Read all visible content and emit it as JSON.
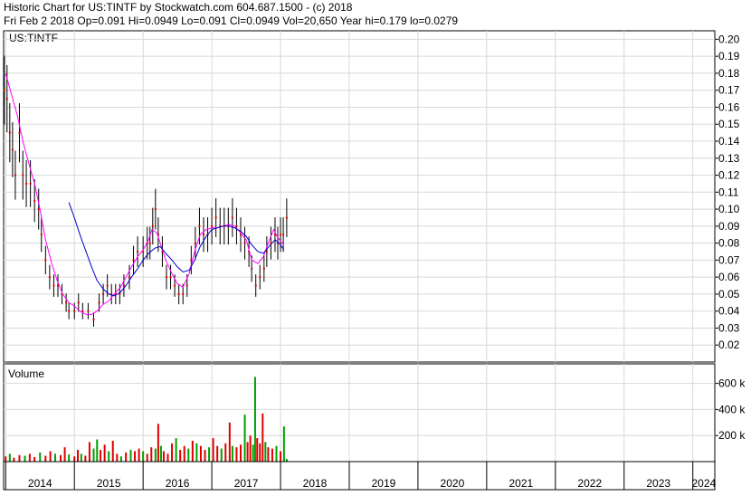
{
  "header": {
    "line1": "Historic Chart for US:TINTF by Stockwatch.com 604.687.1500 - (c) 2018",
    "line2": "Fri Feb  2 2018   Op=0.091   Hi=0.0949   Lo=0.091   Cl=0.0949   Vol=20,650   Year hi=0.179   lo=0.0279"
  },
  "price_panel": {
    "symbol_label": "US:TINTF"
  },
  "volume_panel": {
    "label": "Volume"
  },
  "colors": {
    "ma_short": "#ff00ff",
    "ma_long": "#0000cc",
    "vol_up": "#00a000",
    "vol_down": "#e00000",
    "grid": "#d8d8d8",
    "bars": "#000000"
  },
  "chart_data": [
    {
      "type": "line",
      "title": "Historic Chart for US:TINTF",
      "subtitle": "Fri Feb  2 2018   Op=0.091   Hi=0.0949   Lo=0.091   Cl=0.0949   Vol=20,650   Year hi=0.179   lo=0.0279",
      "ylim": [
        0.01,
        0.205
      ],
      "y_ticks": [
        "0.20",
        "0.19",
        "0.18",
        "0.17",
        "0.16",
        "0.15",
        "0.14",
        "0.13",
        "0.12",
        "0.11",
        "0.10",
        "0.09",
        "0.08",
        "0.07",
        "0.06",
        "0.05",
        "0.04",
        "0.03",
        "0.02"
      ],
      "x_ticks": [
        "2014",
        "2015",
        "2016",
        "2017",
        "2018",
        "2019",
        "2020",
        "2021",
        "2022",
        "2023",
        "2024"
      ],
      "xlim": [
        2013.97,
        2024.32
      ],
      "grid": true,
      "price_points": [
        {
          "x": 2013.98,
          "y": 0.17
        },
        {
          "x": 2014.02,
          "y": 0.165
        },
        {
          "x": 2014.06,
          "y": 0.145
        },
        {
          "x": 2014.1,
          "y": 0.135
        },
        {
          "x": 2014.14,
          "y": 0.12
        },
        {
          "x": 2014.2,
          "y": 0.145
        },
        {
          "x": 2014.25,
          "y": 0.12
        },
        {
          "x": 2014.3,
          "y": 0.115
        },
        {
          "x": 2014.36,
          "y": 0.115
        },
        {
          "x": 2014.42,
          "y": 0.105
        },
        {
          "x": 2014.48,
          "y": 0.1
        },
        {
          "x": 2014.52,
          "y": 0.085
        },
        {
          "x": 2014.58,
          "y": 0.07
        },
        {
          "x": 2014.64,
          "y": 0.06
        },
        {
          "x": 2014.7,
          "y": 0.055
        },
        {
          "x": 2014.76,
          "y": 0.055
        },
        {
          "x": 2014.82,
          "y": 0.05
        },
        {
          "x": 2014.88,
          "y": 0.045
        },
        {
          "x": 2014.92,
          "y": 0.04
        },
        {
          "x": 2015.0,
          "y": 0.04
        },
        {
          "x": 2015.06,
          "y": 0.045
        },
        {
          "x": 2015.12,
          "y": 0.04
        },
        {
          "x": 2015.2,
          "y": 0.04
        },
        {
          "x": 2015.28,
          "y": 0.035
        },
        {
          "x": 2015.36,
          "y": 0.045
        },
        {
          "x": 2015.42,
          "y": 0.05
        },
        {
          "x": 2015.48,
          "y": 0.055
        },
        {
          "x": 2015.54,
          "y": 0.05
        },
        {
          "x": 2015.6,
          "y": 0.05
        },
        {
          "x": 2015.66,
          "y": 0.05
        },
        {
          "x": 2015.72,
          "y": 0.055
        },
        {
          "x": 2015.8,
          "y": 0.06
        },
        {
          "x": 2015.86,
          "y": 0.07
        },
        {
          "x": 2015.92,
          "y": 0.075
        },
        {
          "x": 2016.0,
          "y": 0.075
        },
        {
          "x": 2016.06,
          "y": 0.08
        },
        {
          "x": 2016.1,
          "y": 0.08
        },
        {
          "x": 2016.14,
          "y": 0.09
        },
        {
          "x": 2016.18,
          "y": 0.1
        },
        {
          "x": 2016.22,
          "y": 0.085
        },
        {
          "x": 2016.28,
          "y": 0.075
        },
        {
          "x": 2016.34,
          "y": 0.06
        },
        {
          "x": 2016.4,
          "y": 0.06
        },
        {
          "x": 2016.46,
          "y": 0.055
        },
        {
          "x": 2016.52,
          "y": 0.05
        },
        {
          "x": 2016.58,
          "y": 0.05
        },
        {
          "x": 2016.64,
          "y": 0.055
        },
        {
          "x": 2016.7,
          "y": 0.07
        },
        {
          "x": 2016.76,
          "y": 0.08
        },
        {
          "x": 2016.82,
          "y": 0.09
        },
        {
          "x": 2016.88,
          "y": 0.085
        },
        {
          "x": 2016.94,
          "y": 0.085
        },
        {
          "x": 2017.0,
          "y": 0.09
        },
        {
          "x": 2017.06,
          "y": 0.095
        },
        {
          "x": 2017.12,
          "y": 0.09
        },
        {
          "x": 2017.18,
          "y": 0.09
        },
        {
          "x": 2017.24,
          "y": 0.09
        },
        {
          "x": 2017.3,
          "y": 0.095
        },
        {
          "x": 2017.36,
          "y": 0.09
        },
        {
          "x": 2017.42,
          "y": 0.085
        },
        {
          "x": 2017.48,
          "y": 0.08
        },
        {
          "x": 2017.54,
          "y": 0.075
        },
        {
          "x": 2017.58,
          "y": 0.065
        },
        {
          "x": 2017.64,
          "y": 0.055
        },
        {
          "x": 2017.7,
          "y": 0.06
        },
        {
          "x": 2017.76,
          "y": 0.065
        },
        {
          "x": 2017.8,
          "y": 0.075
        },
        {
          "x": 2017.86,
          "y": 0.08
        },
        {
          "x": 2017.92,
          "y": 0.085
        },
        {
          "x": 2017.96,
          "y": 0.08
        },
        {
          "x": 2018.0,
          "y": 0.085
        },
        {
          "x": 2018.04,
          "y": 0.085
        },
        {
          "x": 2018.09,
          "y": 0.0949
        }
      ],
      "series": [
        {
          "points": [
            [
              2014.0,
              0.18
            ],
            [
              2014.08,
              0.168
            ],
            [
              2014.17,
              0.155
            ],
            [
              2014.25,
              0.14
            ],
            [
              2014.33,
              0.128
            ],
            [
              2014.42,
              0.115
            ],
            [
              2014.5,
              0.1
            ],
            [
              2014.58,
              0.082
            ],
            [
              2014.67,
              0.068
            ],
            [
              2014.75,
              0.058
            ],
            [
              2014.83,
              0.05
            ],
            [
              2014.92,
              0.045
            ],
            [
              2015.0,
              0.043
            ],
            [
              2015.08,
              0.04
            ],
            [
              2015.17,
              0.038
            ],
            [
              2015.25,
              0.038
            ],
            [
              2015.33,
              0.04
            ],
            [
              2015.42,
              0.044
            ],
            [
              2015.5,
              0.046
            ],
            [
              2015.58,
              0.05
            ],
            [
              2015.67,
              0.054
            ],
            [
              2015.75,
              0.06
            ],
            [
              2015.83,
              0.066
            ],
            [
              2015.92,
              0.072
            ],
            [
              2016.0,
              0.076
            ],
            [
              2016.08,
              0.082
            ],
            [
              2016.13,
              0.088
            ],
            [
              2016.2,
              0.086
            ],
            [
              2016.25,
              0.08
            ],
            [
              2016.33,
              0.07
            ],
            [
              2016.42,
              0.062
            ],
            [
              2016.5,
              0.056
            ],
            [
              2016.58,
              0.054
            ],
            [
              2016.67,
              0.062
            ],
            [
              2016.75,
              0.075
            ],
            [
              2016.83,
              0.085
            ],
            [
              2016.92,
              0.088
            ],
            [
              2017.0,
              0.089
            ],
            [
              2017.08,
              0.089
            ],
            [
              2017.17,
              0.09
            ],
            [
              2017.25,
              0.091
            ],
            [
              2017.33,
              0.09
            ],
            [
              2017.42,
              0.086
            ],
            [
              2017.5,
              0.082
            ],
            [
              2017.58,
              0.07
            ],
            [
              2017.67,
              0.068
            ],
            [
              2017.75,
              0.072
            ],
            [
              2017.83,
              0.081
            ],
            [
              2017.9,
              0.088
            ],
            [
              2017.95,
              0.084
            ],
            [
              2018.02,
              0.08
            ],
            [
              2018.05,
              0.079
            ]
          ]
        },
        {
          "points": [
            [
              2014.92,
              0.104
            ],
            [
              2015.0,
              0.095
            ],
            [
              2015.08,
              0.085
            ],
            [
              2015.17,
              0.075
            ],
            [
              2015.25,
              0.066
            ],
            [
              2015.33,
              0.058
            ],
            [
              2015.42,
              0.053
            ],
            [
              2015.5,
              0.05
            ],
            [
              2015.58,
              0.049
            ],
            [
              2015.67,
              0.051
            ],
            [
              2015.75,
              0.055
            ],
            [
              2015.83,
              0.06
            ],
            [
              2015.92,
              0.065
            ],
            [
              2016.0,
              0.07
            ],
            [
              2016.08,
              0.074
            ],
            [
              2016.17,
              0.077
            ],
            [
              2016.25,
              0.078
            ],
            [
              2016.33,
              0.074
            ],
            [
              2016.42,
              0.07
            ],
            [
              2016.5,
              0.066
            ],
            [
              2016.58,
              0.063
            ],
            [
              2016.67,
              0.064
            ],
            [
              2016.75,
              0.07
            ],
            [
              2016.83,
              0.078
            ],
            [
              2016.92,
              0.084
            ],
            [
              2017.0,
              0.088
            ],
            [
              2017.08,
              0.089
            ],
            [
              2017.17,
              0.09
            ],
            [
              2017.25,
              0.09
            ],
            [
              2017.33,
              0.089
            ],
            [
              2017.42,
              0.087
            ],
            [
              2017.5,
              0.084
            ],
            [
              2017.58,
              0.079
            ],
            [
              2017.67,
              0.075
            ],
            [
              2017.75,
              0.074
            ],
            [
              2017.83,
              0.078
            ],
            [
              2017.92,
              0.082
            ],
            [
              2017.98,
              0.08
            ],
            [
              2018.05,
              0.076
            ]
          ]
        }
      ]
    },
    {
      "type": "bar",
      "title": "Volume",
      "ylim": [
        0,
        750000
      ],
      "y_ticks": [
        "600 k",
        "400 k",
        "200 k"
      ],
      "y_tick_values": [
        600000,
        400000,
        200000
      ],
      "grid": true,
      "bars": [
        {
          "x": 2014.0,
          "v": 40000,
          "up": false
        },
        {
          "x": 2014.06,
          "v": 60000,
          "up": true
        },
        {
          "x": 2014.12,
          "v": 30000,
          "up": false
        },
        {
          "x": 2014.2,
          "v": 50000,
          "up": false
        },
        {
          "x": 2014.28,
          "v": 45000,
          "up": true
        },
        {
          "x": 2014.35,
          "v": 60000,
          "up": false
        },
        {
          "x": 2014.42,
          "v": 35000,
          "up": false
        },
        {
          "x": 2014.5,
          "v": 70000,
          "up": true
        },
        {
          "x": 2014.58,
          "v": 45000,
          "up": false
        },
        {
          "x": 2014.65,
          "v": 80000,
          "up": false
        },
        {
          "x": 2014.72,
          "v": 60000,
          "up": true
        },
        {
          "x": 2014.8,
          "v": 50000,
          "up": false
        },
        {
          "x": 2014.86,
          "v": 110000,
          "up": false
        },
        {
          "x": 2014.92,
          "v": 55000,
          "up": true
        },
        {
          "x": 2015.0,
          "v": 40000,
          "up": false
        },
        {
          "x": 2015.05,
          "v": 90000,
          "up": false
        },
        {
          "x": 2015.1,
          "v": 60000,
          "up": true
        },
        {
          "x": 2015.16,
          "v": 45000,
          "up": false
        },
        {
          "x": 2015.22,
          "v": 150000,
          "up": false
        },
        {
          "x": 2015.28,
          "v": 100000,
          "up": true
        },
        {
          "x": 2015.33,
          "v": 170000,
          "up": true
        },
        {
          "x": 2015.38,
          "v": 90000,
          "up": false
        },
        {
          "x": 2015.44,
          "v": 130000,
          "up": false
        },
        {
          "x": 2015.5,
          "v": 80000,
          "up": true
        },
        {
          "x": 2015.56,
          "v": 160000,
          "up": false
        },
        {
          "x": 2015.62,
          "v": 60000,
          "up": false
        },
        {
          "x": 2015.68,
          "v": 40000,
          "up": true
        },
        {
          "x": 2015.75,
          "v": 70000,
          "up": false
        },
        {
          "x": 2015.82,
          "v": 90000,
          "up": true
        },
        {
          "x": 2015.88,
          "v": 80000,
          "up": false
        },
        {
          "x": 2015.94,
          "v": 100000,
          "up": false
        },
        {
          "x": 2016.0,
          "v": 80000,
          "up": true
        },
        {
          "x": 2016.06,
          "v": 60000,
          "up": false
        },
        {
          "x": 2016.12,
          "v": 110000,
          "up": false
        },
        {
          "x": 2016.18,
          "v": 100000,
          "up": true
        },
        {
          "x": 2016.22,
          "v": 290000,
          "up": false
        },
        {
          "x": 2016.26,
          "v": 120000,
          "up": true
        },
        {
          "x": 2016.3,
          "v": 80000,
          "up": false
        },
        {
          "x": 2016.36,
          "v": 60000,
          "up": false
        },
        {
          "x": 2016.42,
          "v": 140000,
          "up": false
        },
        {
          "x": 2016.48,
          "v": 180000,
          "up": true
        },
        {
          "x": 2016.54,
          "v": 90000,
          "up": false
        },
        {
          "x": 2016.6,
          "v": 120000,
          "up": false
        },
        {
          "x": 2016.66,
          "v": 100000,
          "up": true
        },
        {
          "x": 2016.72,
          "v": 160000,
          "up": false
        },
        {
          "x": 2016.78,
          "v": 140000,
          "up": true
        },
        {
          "x": 2016.84,
          "v": 120000,
          "up": false
        },
        {
          "x": 2016.9,
          "v": 90000,
          "up": false
        },
        {
          "x": 2016.96,
          "v": 110000,
          "up": true
        },
        {
          "x": 2017.02,
          "v": 180000,
          "up": false
        },
        {
          "x": 2017.08,
          "v": 120000,
          "up": false
        },
        {
          "x": 2017.14,
          "v": 100000,
          "up": true
        },
        {
          "x": 2017.2,
          "v": 140000,
          "up": false
        },
        {
          "x": 2017.26,
          "v": 300000,
          "up": false
        },
        {
          "x": 2017.3,
          "v": 120000,
          "up": true
        },
        {
          "x": 2017.36,
          "v": 110000,
          "up": false
        },
        {
          "x": 2017.42,
          "v": 130000,
          "up": false
        },
        {
          "x": 2017.48,
          "v": 360000,
          "up": true
        },
        {
          "x": 2017.52,
          "v": 150000,
          "up": false
        },
        {
          "x": 2017.56,
          "v": 200000,
          "up": false
        },
        {
          "x": 2017.6,
          "v": 130000,
          "up": true
        },
        {
          "x": 2017.63,
          "v": 650000,
          "up": true
        },
        {
          "x": 2017.66,
          "v": 180000,
          "up": false
        },
        {
          "x": 2017.7,
          "v": 140000,
          "up": false
        },
        {
          "x": 2017.74,
          "v": 370000,
          "up": false
        },
        {
          "x": 2017.78,
          "v": 150000,
          "up": true
        },
        {
          "x": 2017.82,
          "v": 110000,
          "up": false
        },
        {
          "x": 2017.88,
          "v": 100000,
          "up": false
        },
        {
          "x": 2017.94,
          "v": 120000,
          "up": true
        },
        {
          "x": 2018.0,
          "v": 80000,
          "up": false
        },
        {
          "x": 2018.05,
          "v": 270000,
          "up": true
        },
        {
          "x": 2018.09,
          "v": 20650,
          "up": true
        }
      ]
    }
  ]
}
